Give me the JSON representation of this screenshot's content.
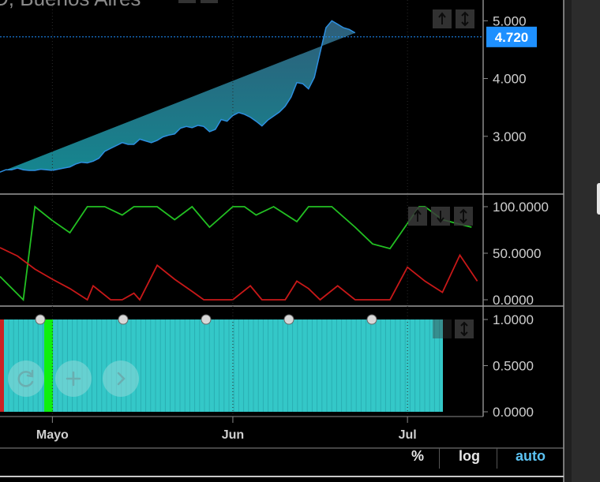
{
  "chart_title_fragment": "D, Buenos Aires",
  "price_label": "4.720",
  "scale_options": {
    "percent": "%",
    "log": "log",
    "auto": "auto"
  },
  "colors": {
    "area_top": "#2f6f88",
    "area_bottom": "#16858e",
    "price_line": "#2d8fe0",
    "price_badge": "#1e90ff",
    "osc_green": "#22c022",
    "osc_red": "#c81818",
    "volume_bar": "#34c8c8",
    "marker_green": "#0ef00e",
    "marker_red": "#cc2222"
  },
  "icons": {
    "price_panel": [
      "arrow-up-icon",
      "arrows-vertical-icon"
    ],
    "osc_panel": [
      "arrow-up-icon",
      "arrow-down-icon",
      "arrows-vertical-icon"
    ],
    "vol_panel": [
      "arrows-vertical-icon"
    ],
    "nav": [
      "refresh-icon",
      "plus-icon",
      "chevron-right-icon"
    ]
  },
  "chart_data": [
    {
      "type": "area",
      "panel": "price",
      "x_categories_ticks": [
        "Mayo",
        "Jun",
        "Jul"
      ],
      "x_tick_positions_days": [
        6,
        37,
        67
      ],
      "x_start_day": -3,
      "x_end_day": 80,
      "yticks": [
        "5.000",
        "4.000",
        "3.000"
      ],
      "ytick_values": [
        5,
        4,
        3
      ],
      "ylim": [
        2.0,
        5.25
      ],
      "grid": false,
      "last_value_label": "4.720",
      "x": [
        -3,
        -2,
        -1,
        0,
        1,
        2,
        3,
        4,
        5,
        6,
        7,
        8,
        9,
        10,
        11,
        12,
        13,
        14,
        15,
        16,
        17,
        18,
        19,
        20,
        21,
        22,
        23,
        24,
        25,
        26,
        27,
        28,
        29,
        30,
        31,
        32,
        33,
        34,
        35,
        36,
        37,
        38,
        39,
        40,
        41,
        42,
        43,
        44,
        45,
        46,
        47,
        48,
        49,
        50,
        51,
        52,
        53,
        54,
        55,
        56,
        57,
        58,
        59,
        60,
        61,
        62,
        63,
        64,
        65,
        66,
        67,
        68,
        69,
        70,
        71,
        72,
        73,
        74,
        75,
        76
      ],
      "y": [
        2.38,
        2.42,
        2.42,
        2.45,
        2.42,
        2.41,
        2.41,
        2.43,
        2.42,
        2.41,
        2.43,
        2.45,
        2.47,
        2.52,
        2.55,
        2.54,
        2.57,
        2.62,
        2.74,
        2.79,
        2.84,
        2.89,
        2.86,
        2.86,
        2.95,
        2.92,
        2.89,
        2.93,
        2.99,
        3.02,
        3.04,
        3.14,
        3.17,
        3.15,
        3.19,
        3.17,
        3.08,
        3.12,
        3.29,
        3.26,
        3.36,
        3.41,
        3.38,
        3.33,
        3.26,
        3.18,
        3.28,
        3.35,
        3.42,
        3.52,
        3.68,
        3.93,
        3.91,
        3.82,
        4.02,
        4.45,
        4.88,
        5.0,
        4.94,
        4.88,
        4.85,
        4.79
      ]
    },
    {
      "type": "line",
      "panel": "oscillator",
      "yticks": [
        "100.0000",
        "50.0000",
        "0.0000"
      ],
      "ytick_values": [
        100,
        50,
        0
      ],
      "ylim": [
        -5,
        105
      ],
      "series": [
        {
          "color": "green",
          "x": [
            -3,
            1,
            3,
            6,
            9,
            12,
            15,
            18,
            20,
            24,
            27,
            30,
            33,
            37,
            39,
            41,
            44,
            48,
            50,
            54,
            58,
            61,
            64,
            69,
            70,
            73,
            78
          ],
          "y": [
            25,
            0,
            100,
            85,
            72,
            100,
            100,
            91,
            100,
            100,
            86,
            100,
            78,
            100,
            100,
            91,
            100,
            84,
            100,
            100,
            78,
            60,
            55,
            100,
            100,
            86,
            78
          ]
        },
        {
          "color": "red",
          "x": [
            -3,
            0,
            3,
            6,
            9,
            12,
            13,
            16,
            18,
            20,
            21,
            24,
            27,
            30,
            32,
            34,
            37,
            40,
            42,
            44,
            46,
            48,
            50,
            52,
            55,
            58,
            59,
            61,
            64,
            67,
            70,
            73,
            76,
            79
          ],
          "y": [
            56,
            47,
            33,
            22,
            12,
            0,
            15,
            0,
            0,
            7,
            0,
            37,
            22,
            9,
            0,
            0,
            0,
            15,
            0,
            0,
            0,
            20,
            12,
            0,
            15,
            0,
            0,
            0,
            0,
            35,
            20,
            8,
            48,
            20
          ]
        }
      ]
    },
    {
      "type": "bar",
      "panel": "volume",
      "yticks": [
        "1.0000",
        "0.5000",
        "0.0000"
      ],
      "ytick_values": [
        1,
        0.5,
        0
      ],
      "ylim": [
        0,
        1
      ],
      "bar_value": 1.0
    }
  ]
}
